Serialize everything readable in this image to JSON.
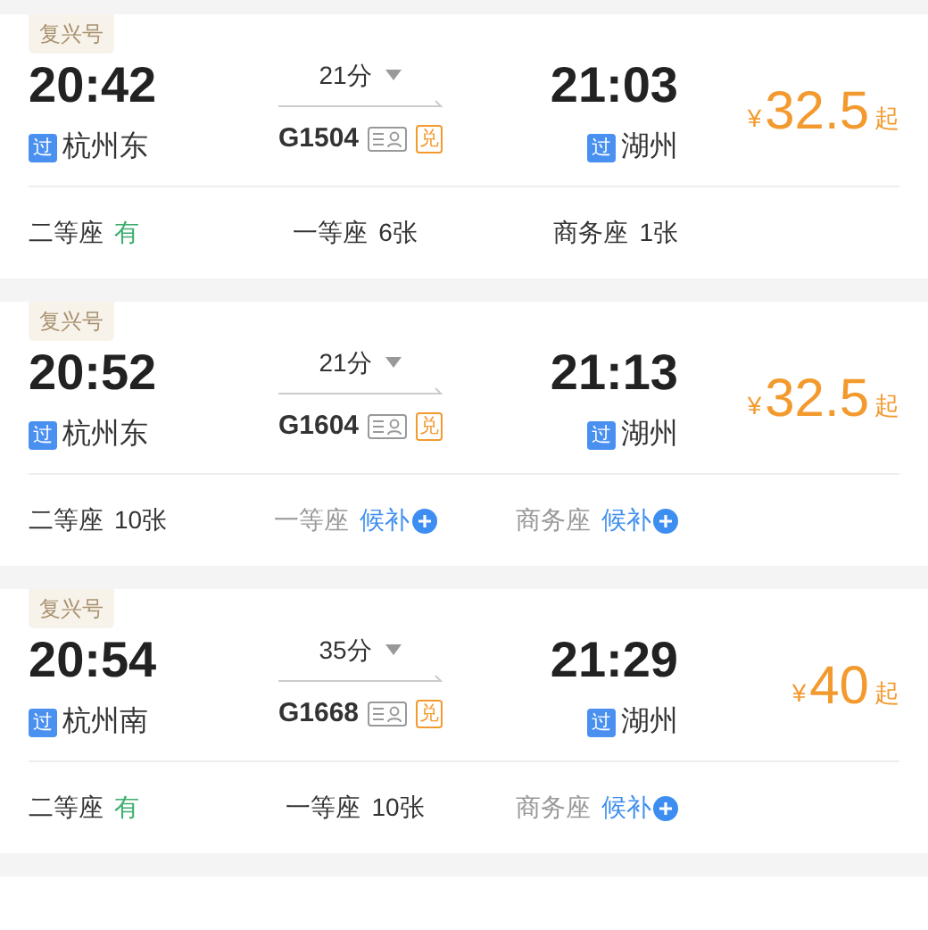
{
  "trains": [
    {
      "badge": "复兴号",
      "depart_time": "20:42",
      "depart_station": "杭州东",
      "depart_tag": "过",
      "duration": "21分",
      "train_no": "G1504",
      "exchange_tag": "兑",
      "arrive_time": "21:03",
      "arrive_station": "湖州",
      "arrive_tag": "过",
      "currency": "¥",
      "price": "32.5",
      "price_suffix": "起",
      "seats": [
        {
          "label": "二等座",
          "value": "有",
          "kind": "plenty"
        },
        {
          "label": "一等座",
          "value": "6张",
          "kind": "count"
        },
        {
          "label": "商务座",
          "value": "1张",
          "kind": "count"
        }
      ]
    },
    {
      "badge": "复兴号",
      "depart_time": "20:52",
      "depart_station": "杭州东",
      "depart_tag": "过",
      "duration": "21分",
      "train_no": "G1604",
      "exchange_tag": "兑",
      "arrive_time": "21:13",
      "arrive_station": "湖州",
      "arrive_tag": "过",
      "currency": "¥",
      "price": "32.5",
      "price_suffix": "起",
      "seats": [
        {
          "label": "二等座",
          "value": "10张",
          "kind": "count"
        },
        {
          "label": "一等座",
          "value": "候补",
          "kind": "waitlist"
        },
        {
          "label": "商务座",
          "value": "候补",
          "kind": "waitlist"
        }
      ]
    },
    {
      "badge": "复兴号",
      "depart_time": "20:54",
      "depart_station": "杭州南",
      "depart_tag": "过",
      "duration": "35分",
      "train_no": "G1668",
      "exchange_tag": "兑",
      "arrive_time": "21:29",
      "arrive_station": "湖州",
      "arrive_tag": "过",
      "currency": "¥",
      "price": "40",
      "price_suffix": "起",
      "seats": [
        {
          "label": "二等座",
          "value": "有",
          "kind": "plenty"
        },
        {
          "label": "一等座",
          "value": "10张",
          "kind": "count"
        },
        {
          "label": "商务座",
          "value": "候补",
          "kind": "waitlist"
        }
      ]
    }
  ]
}
